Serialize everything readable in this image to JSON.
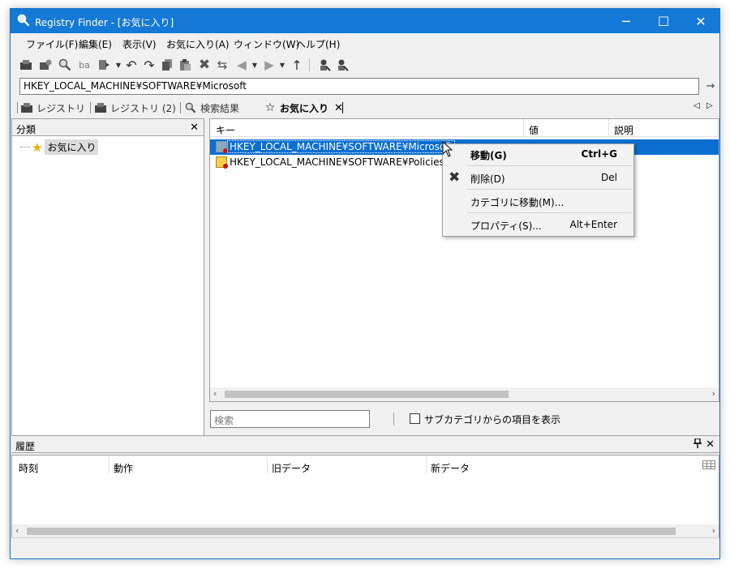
{
  "window": {
    "title": "Registry Finder - [お気に入り]",
    "minimize_glyph": "─",
    "maximize_glyph": "☐",
    "close_glyph": "✕"
  },
  "menu": [
    "ファイル(F)",
    "編集(E)",
    "表示(V)",
    "お気に入り(A)",
    "ウィンドウ(W)",
    "ヘルプ(H)"
  ],
  "toolbar_icons": [
    "computer-icon",
    "remote-computer-icon",
    "find-icon",
    "find-text-icon",
    "export-icon",
    "undo-icon",
    "redo-icon",
    "copy-icon",
    "paste-icon",
    "delete-icon",
    "rename-icon",
    "back-icon",
    "forward-icon",
    "up-icon",
    "find-people-icon",
    "find-people-2-icon"
  ],
  "address": {
    "value": "HKEY_LOCAL_MACHINE¥SOFTWARE¥Microsoft",
    "go_glyph": "→"
  },
  "tabs": [
    {
      "label": "レジストリ"
    },
    {
      "label": "レジストリ (2)"
    },
    {
      "label": "検索結果"
    },
    {
      "label": "お気に入り",
      "active": true
    }
  ],
  "tab_nav": {
    "prev": "◁",
    "next": "▷"
  },
  "left_pane": {
    "title": "分類",
    "close_glyph": "✕",
    "tree": [
      {
        "label": "お気に入り"
      }
    ]
  },
  "list": {
    "columns": [
      "キー",
      "値",
      "説明"
    ],
    "rows": [
      {
        "key": "HKEY_LOCAL_MACHINE¥SOFTWARE¥Microsoft",
        "selected": true
      },
      {
        "key": "HKEY_LOCAL_MACHINE¥SOFTWARE¥Policies¥Mic",
        "selected": false
      }
    ]
  },
  "search": {
    "placeholder": "検索"
  },
  "subcategory_checkbox": {
    "label": "サブカテゴリからの項目を表示",
    "checked": false
  },
  "history": {
    "title": "履歴",
    "pin_glyph": "📌",
    "close_glyph": "✕",
    "columns": [
      "時刻",
      "動作",
      "旧データ",
      "新データ"
    ]
  },
  "context_menu": {
    "items": [
      {
        "label": "移動(G)",
        "shortcut": "Ctrl+G",
        "bold": true
      },
      {
        "label": "削除(D)",
        "shortcut": "Del",
        "icon": "delete-icon"
      },
      {
        "label": "カテゴリに移動(M)...",
        "shortcut": ""
      },
      {
        "label": "プロパティ(S)...",
        "shortcut": "Alt+Enter"
      }
    ]
  },
  "colors": {
    "titlebar": "#1479d7",
    "selection": "#0b6ed1",
    "star": "#f5a800"
  }
}
